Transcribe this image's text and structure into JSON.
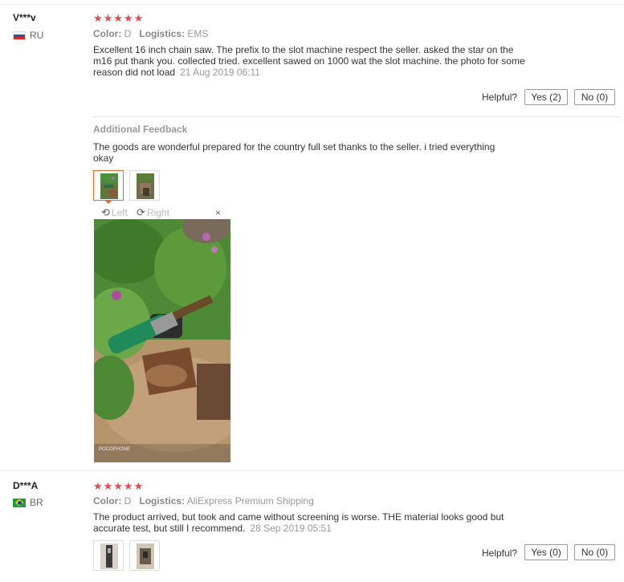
{
  "reviews": [
    {
      "user": "V***v",
      "country": "RU",
      "stars": "★★★★★",
      "color_label": "Color:",
      "color_value": "D",
      "logistics_label": "Logistics:",
      "logistics_value": "EMS",
      "text_line1": "Excellent 16 inch chain saw. The prefix to the slot machine respect the seller. asked the star on the",
      "text_line2": "m16 put thank you. collected tried. excellent sawed on 1000 wat the slot machine. the photo for some",
      "text_line3": "reason did not load",
      "date": "21 Aug 2019 06:11",
      "helpful_label": "Helpful?",
      "yes_label": "Yes (2)",
      "no_label": "No (0)",
      "additional": {
        "title": "Additional Feedback",
        "text_line1": "The goods are wonderful prepared for the country full set thanks to the seller. i tried everything",
        "text_line2": "okay",
        "rotate_left": "Left",
        "rotate_right": "Right",
        "close": "×",
        "photo_caption": "POCOPHONE"
      }
    },
    {
      "user": "D***A",
      "country": "BR",
      "stars": "★★★★★",
      "color_label": "Color:",
      "color_value": "D",
      "logistics_label": "Logistics:",
      "logistics_value": "AliExpress Premium Shipping",
      "text_line1": "The product arrived, but took and came without screening is worse. THE material looks good but",
      "text_line2": "accurate test, but still I recommend.",
      "date": "28 Sep 2019 05:51",
      "helpful_label": "Helpful?",
      "yes_label": "Yes (0)",
      "no_label": "No (0)"
    }
  ],
  "colors": {
    "stars": "#e8494b",
    "active_thumb": "#e86b2a",
    "meta": "#999999"
  },
  "icons": [
    "rotate-left-icon",
    "rotate-right-icon",
    "close-icon",
    "flag-ru-icon",
    "flag-br-icon"
  ]
}
